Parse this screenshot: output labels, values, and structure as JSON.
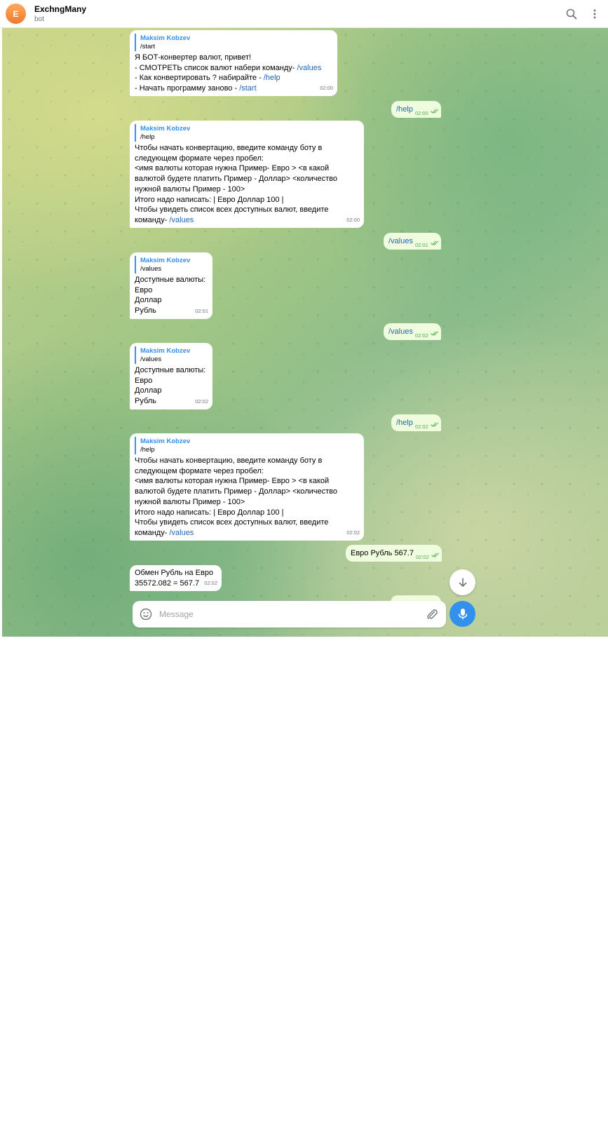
{
  "header": {
    "avatar_letter": "E",
    "title": "ExchngMany",
    "subtitle": "bot",
    "search_icon": "search-icon",
    "menu_icon": "more-vert-icon"
  },
  "messages": [
    {
      "side": "in",
      "reply_name": "Maksim Kobzev",
      "reply_text": "/start",
      "lines": [
        "Я БОТ-конвертер валют, привет!",
        "- СМОТРЕТЬ список валют набери команду- ",
        "/values",
        "- Как конвертировать ? набирайте - ",
        "/help",
        "- Начать программу заново - ",
        "/start"
      ],
      "time": "02:00"
    },
    {
      "side": "out",
      "text": "/help",
      "time": "02:00"
    },
    {
      "side": "in",
      "reply_name": "Maksim Kobzev",
      "reply_text": "/help",
      "lines": [
        "Чтобы начать конвертацию, введите команду боту в",
        "следующем формате через пробел:",
        "<имя валюты которая нужна Пример- Евро > <в какой",
        "валютой будете платить  Пример - Доллар> <количество",
        "нужной валюты Пример - 100>",
        "Итого надо написать: | Евро Доллар 100 |",
        "Чтобы увидеть список всех доступных валют, введите",
        "команду- ",
        "/values"
      ],
      "time": "02:00"
    },
    {
      "side": "out",
      "text": "/values",
      "time": "02:01"
    },
    {
      "side": "in",
      "reply_name": "Maksim Kobzev",
      "reply_text": "/values",
      "lines": [
        "Доступные валюты:",
        "Евро",
        "Доллар",
        "Рубль"
      ],
      "time": "02:01"
    },
    {
      "side": "out",
      "text": "/values",
      "time": "02:02"
    },
    {
      "side": "in",
      "reply_name": "Maksim Kobzev",
      "reply_text": "/values",
      "lines": [
        "Доступные валюты:",
        "Евро",
        "Доллар",
        "Рубль"
      ],
      "time": "02:02"
    },
    {
      "side": "out",
      "text": "/help",
      "time": "02:02"
    },
    {
      "side": "in",
      "reply_name": "Maksim Kobzev",
      "reply_text": "/help",
      "lines": [
        "Чтобы начать конвертацию, введите команду боту в",
        "следующем формате через пробел:",
        "<имя валюты которая нужна Пример- Евро > <в какой",
        "валютой будете платить  Пример - Доллар> <количество",
        "нужной валюты Пример - 100>",
        "Итого надо написать: | Евро Доллар 100 |",
        "Чтобы увидеть список всех доступных валют, введите",
        "команду- ",
        "/values"
      ],
      "time": "02:02"
    },
    {
      "side": "out",
      "text": "Евро Рубль 567.7",
      "time": "02:02"
    },
    {
      "side": "in",
      "lines": [
        "Обмен Рубль на Евро",
        "35572.082  = 567.7"
      ],
      "time": "02:02"
    }
  ],
  "composer": {
    "placeholder": "Message",
    "emoji_icon": "smile-icon",
    "attach_icon": "paperclip-icon",
    "mic_icon": "microphone-icon",
    "scroll_down_icon": "arrow-down-icon"
  },
  "colors": {
    "accent": "#3390ec",
    "link": "#1f66b2",
    "out_bubble": "#effdde",
    "in_bubble": "#ffffff",
    "check": "#4fae4e"
  }
}
